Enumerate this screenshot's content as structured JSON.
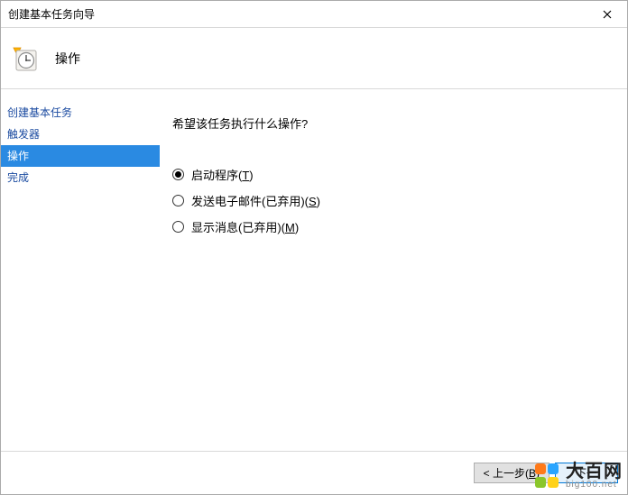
{
  "titlebar": {
    "title": "创建基本任务向导"
  },
  "header": {
    "title": "操作"
  },
  "sidebar": {
    "items": [
      {
        "label": "创建基本任务",
        "selected": false
      },
      {
        "label": "触发器",
        "selected": false
      },
      {
        "label": "操作",
        "selected": true
      },
      {
        "label": "完成",
        "selected": false
      }
    ]
  },
  "content": {
    "question": "希望该任务执行什么操作?",
    "options": [
      {
        "label": "启动程序(",
        "mnemonic": "T",
        "suffix": ")",
        "checked": true
      },
      {
        "label": "发送电子邮件(已弃用)(",
        "mnemonic": "S",
        "suffix": ")",
        "checked": false
      },
      {
        "label": "显示消息(已弃用)(",
        "mnemonic": "M",
        "suffix": ")",
        "checked": false
      }
    ]
  },
  "footer": {
    "back": "< 上一步(",
    "back_mn": "B",
    "back_suffix": ")",
    "next": "下一"
  },
  "watermark": {
    "brand": "大百网",
    "url": "big100.net",
    "colors": [
      "#ff7a1a",
      "#2aa5ff",
      "#8ac62a",
      "#ffd21a"
    ]
  }
}
